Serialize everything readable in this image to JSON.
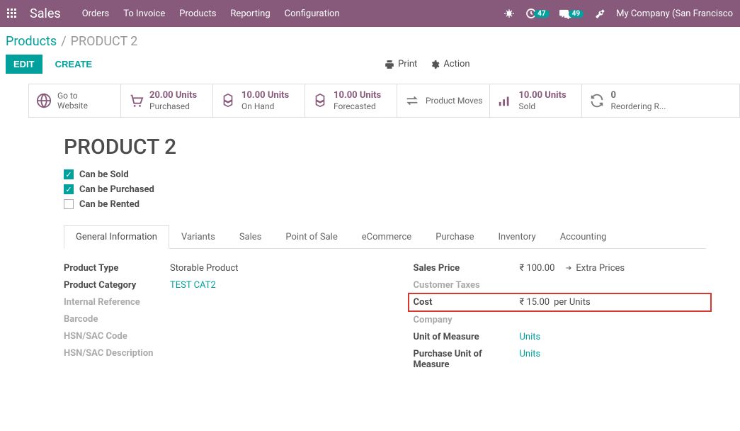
{
  "topbar": {
    "brand": "Sales",
    "menu": [
      "Orders",
      "To Invoice",
      "Products",
      "Reporting",
      "Configuration"
    ],
    "activity_count": "47",
    "discuss_count": "49",
    "company": "My Company (San Francisco"
  },
  "breadcrumb": {
    "parent": "Products",
    "current": "PRODUCT 2"
  },
  "actions": {
    "edit": "EDIT",
    "create": "CREATE",
    "print": "Print",
    "action": "Action"
  },
  "stats": {
    "website": {
      "line1": "Go to",
      "line2": "Website"
    },
    "purchased": {
      "val": "20.00 Units",
      "lbl": "Purchased"
    },
    "onhand": {
      "val": "10.00 Units",
      "lbl": "On Hand"
    },
    "forecast": {
      "val": "10.00 Units",
      "lbl": "Forecasted"
    },
    "moves": {
      "lbl": "Product Moves"
    },
    "sold": {
      "val": "10.00 Units",
      "lbl": "Sold"
    },
    "reorder": {
      "val": "0",
      "lbl": "Reordering R..."
    }
  },
  "product": {
    "name": "PRODUCT 2",
    "can_sold": "Can be Sold",
    "can_purchased": "Can be Purchased",
    "can_rented": "Can be Rented"
  },
  "tabs": [
    "General Information",
    "Variants",
    "Sales",
    "Point of Sale",
    "eCommerce",
    "Purchase",
    "Inventory",
    "Accounting"
  ],
  "general": {
    "left": {
      "product_type_lbl": "Product Type",
      "product_type_val": "Storable Product",
      "category_lbl": "Product Category",
      "category_val": "TEST CAT2",
      "internal_ref_lbl": "Internal Reference",
      "barcode_lbl": "Barcode",
      "hsn_code_lbl": "HSN/SAC Code",
      "hsn_desc_lbl": "HSN/SAC Description"
    },
    "right": {
      "sales_price_lbl": "Sales Price",
      "sales_price_val": "₹ 100.00",
      "extra_prices": "Extra Prices",
      "cust_tax_lbl": "Customer Taxes",
      "cost_lbl": "Cost",
      "cost_val": "₹ 15.00",
      "cost_unit": "per Units",
      "company_lbl": "Company",
      "uom_lbl": "Unit of Measure",
      "uom_val": "Units",
      "puom_lbl": "Purchase Unit of Measure",
      "puom_val": "Units"
    }
  }
}
